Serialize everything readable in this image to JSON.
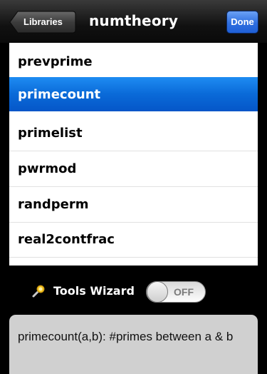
{
  "navbar": {
    "back_label": "Libraries",
    "title": "numtheory",
    "done_label": "Done"
  },
  "functions": [
    {
      "name": "prevprime",
      "selected": false
    },
    {
      "name": "primecount",
      "selected": true
    },
    {
      "name": "primelist",
      "selected": false
    },
    {
      "name": "pwrmod",
      "selected": false
    },
    {
      "name": "randperm",
      "selected": false
    },
    {
      "name": "real2contfrac",
      "selected": false
    },
    {
      "name": "",
      "selected": false
    }
  ],
  "tools": {
    "icon": "magic-wand-icon",
    "label": "Tools Wizard",
    "toggle_state": "OFF"
  },
  "description": "primecount(a,b): #primes between a & b",
  "colors": {
    "selection": "#0a6ad8",
    "done_button": "#2f6fe0",
    "background": "#000000"
  }
}
